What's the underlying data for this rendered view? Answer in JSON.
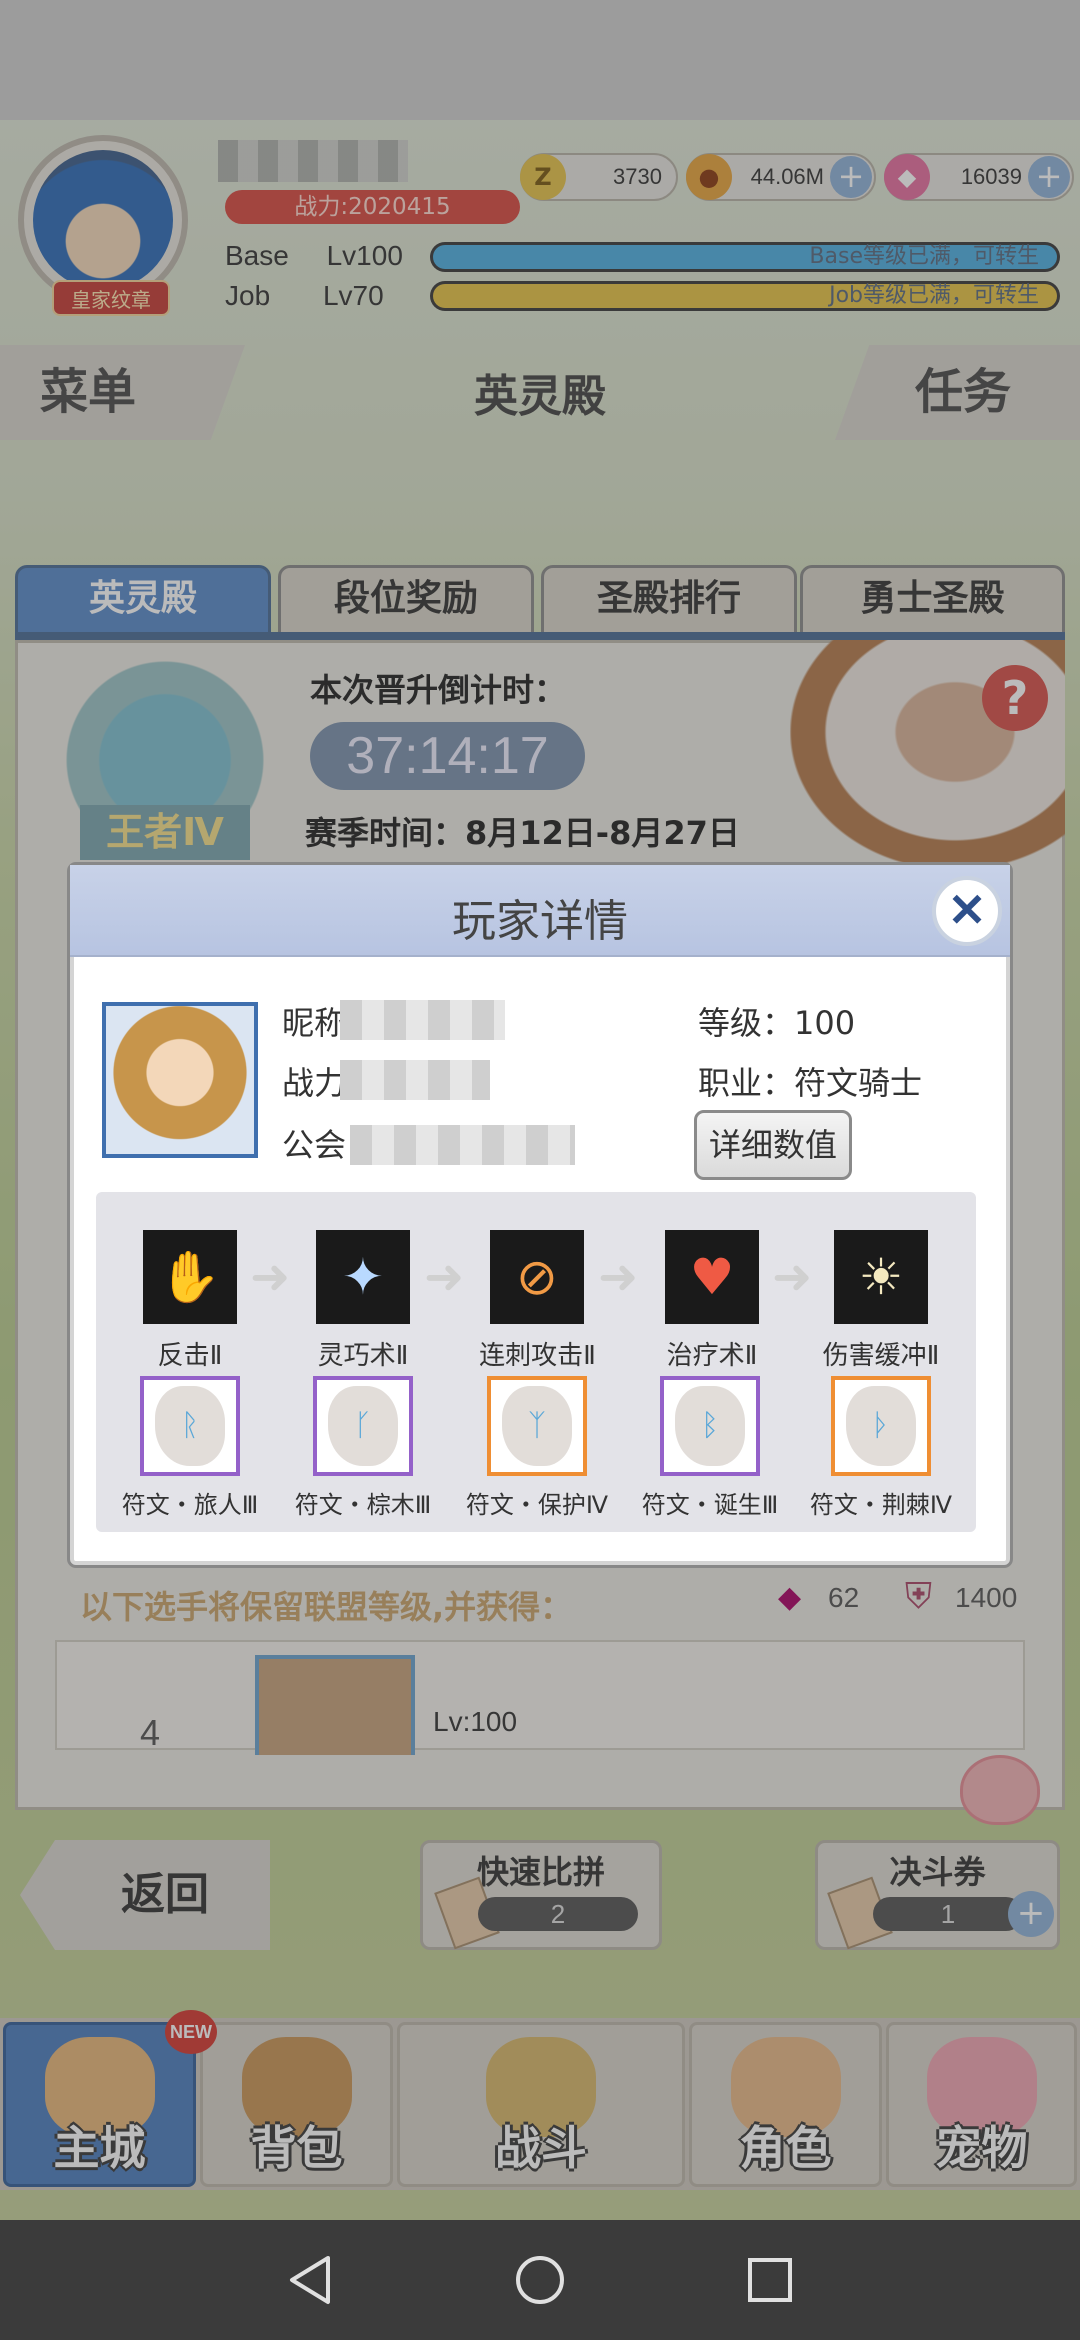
{
  "header": {
    "badge": "皇家纹章",
    "power": "战力:2020415",
    "resources": [
      {
        "icon": "zeny-coin-icon",
        "value": "3730"
      },
      {
        "icon": "gold-pot-icon",
        "value": "44.06M"
      },
      {
        "icon": "pink-gem-icon",
        "value": "16039"
      }
    ],
    "base_label": "Base",
    "base_level": "Lv100",
    "base_bar_text": "Base等级已满，可转生",
    "job_label": "Job",
    "job_level": "Lv70",
    "job_bar_text": "Job等级已满，可转生"
  },
  "nav": {
    "menu": "菜单",
    "title": "英灵殿",
    "task": "任务"
  },
  "tabs": [
    "英灵殿",
    "段位奖励",
    "圣殿排行",
    "勇士圣殿"
  ],
  "hall": {
    "rank_label": "王者Ⅳ",
    "countdown_label": "本次晋升倒计时：",
    "countdown": "37:14:17",
    "season": "赛季时间：8月12日-8月27日",
    "retain_text": "以下选手将保留联盟等级,并获得：",
    "gem_value": "62",
    "shield_value": "1400",
    "row_rank": "4",
    "row_level": "Lv:100"
  },
  "modal": {
    "title": "玩家详情",
    "nickname_label": "昵称",
    "power_label": "战力",
    "guild_label": "公会",
    "level_label": "等级：",
    "level_value": "100",
    "job_label": "职业：",
    "job_value": "符文骑士",
    "detail_button": "详细数值",
    "skills": [
      {
        "name": "反击Ⅱ",
        "icon": "counter-attack-icon",
        "color": "#9ec9ef"
      },
      {
        "name": "灵巧术Ⅱ",
        "icon": "agility-icon",
        "color": "#b9d9ff"
      },
      {
        "name": "连刺攻击Ⅱ",
        "icon": "pierce-attack-icon",
        "color": "#f19a45"
      },
      {
        "name": "治疗术Ⅱ",
        "icon": "heal-icon",
        "color": "#ef5a44"
      },
      {
        "name": "伤害缓冲Ⅱ",
        "icon": "damage-buffer-icon",
        "color": "#f4e9c0"
      }
    ],
    "runes": [
      {
        "name": "符文・旅人Ⅲ",
        "rune": "ᚱ",
        "frame": "purple"
      },
      {
        "name": "符文・棕木Ⅲ",
        "rune": "ᚴ",
        "frame": "purple"
      },
      {
        "name": "符文・保护Ⅳ",
        "rune": "ᛉ",
        "frame": "orange"
      },
      {
        "name": "符文・诞生Ⅲ",
        "rune": "ᛒ",
        "frame": "purple"
      },
      {
        "name": "符文・荆棘Ⅳ",
        "rune": "ᚦ",
        "frame": "orange"
      }
    ]
  },
  "bottom": {
    "back": "返回",
    "quick_match": "快速比拼",
    "quick_count": "2",
    "duel_ticket": "决斗券",
    "duel_count": "1"
  },
  "main_nav": {
    "new_badge": "NEW",
    "items": [
      "主城",
      "背包",
      "战斗",
      "角色",
      "宠物"
    ]
  }
}
